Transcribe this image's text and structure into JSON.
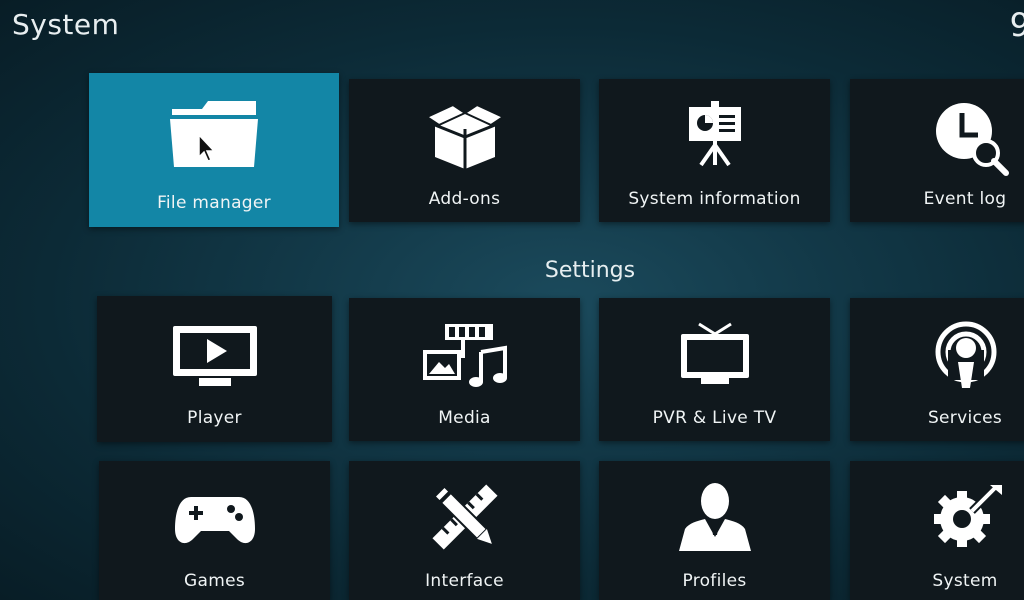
{
  "header": {
    "title": "System",
    "clock": "9"
  },
  "top_row": [
    {
      "label": "File manager",
      "icon": "folder-icon",
      "focused": true
    },
    {
      "label": "Add-ons",
      "icon": "box-icon"
    },
    {
      "label": "System information",
      "icon": "presentation-icon"
    },
    {
      "label": "Event log",
      "icon": "clock-search-icon"
    }
  ],
  "settings": {
    "heading": "Settings",
    "items": [
      {
        "label": "Player",
        "icon": "play-screen-icon"
      },
      {
        "label": "Media",
        "icon": "media-icon"
      },
      {
        "label": "PVR & Live TV",
        "icon": "tv-icon"
      },
      {
        "label": "Services",
        "icon": "podcast-icon"
      },
      {
        "label": "Games",
        "icon": "gamepad-icon"
      },
      {
        "label": "Interface",
        "icon": "pencil-ruler-icon"
      },
      {
        "label": "Profiles",
        "icon": "profile-icon"
      },
      {
        "label": "System",
        "icon": "gear-tools-icon"
      }
    ]
  },
  "colors": {
    "focus": "#1386a6",
    "tile": "#10181d",
    "background": "#123847"
  }
}
